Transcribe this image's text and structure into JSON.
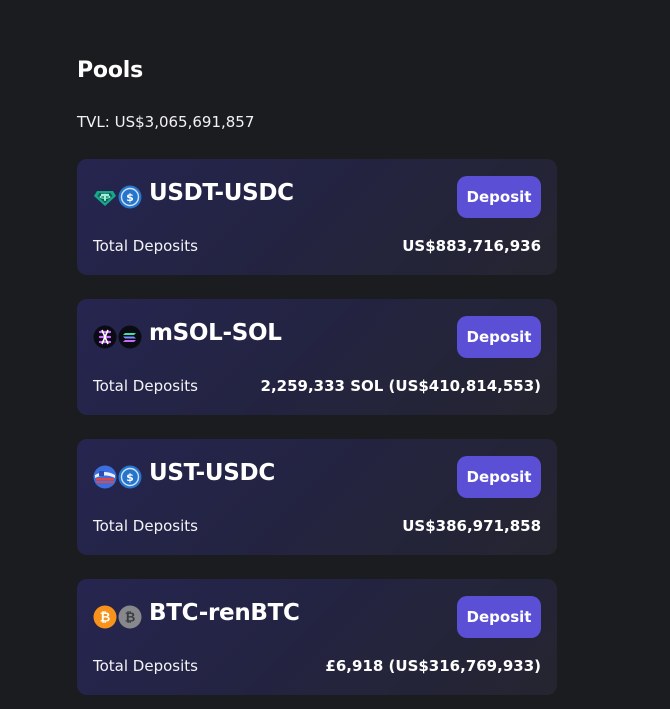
{
  "header": {
    "title": "Pools",
    "tvl_text": "TVL: US$3,065,691,857"
  },
  "colors": {
    "background": "#1b1c20",
    "card": "#24243f",
    "accent": "#5b4fd6"
  },
  "pools": [
    {
      "name": "USDT-USDC",
      "icons": [
        "usdt-icon",
        "usdc-icon"
      ],
      "deposit_label": "Deposit",
      "deposits_label": "Total Deposits",
      "deposits_value": "US$883,716,936"
    },
    {
      "name": "mSOL-SOL",
      "icons": [
        "msol-icon",
        "sol-icon"
      ],
      "deposit_label": "Deposit",
      "deposits_label": "Total Deposits",
      "deposits_value": "2,259,333 SOL (US$410,814,553)"
    },
    {
      "name": "UST-USDC",
      "icons": [
        "ust-icon",
        "usdc-icon"
      ],
      "deposit_label": "Deposit",
      "deposits_label": "Total Deposits",
      "deposits_value": "US$386,971,858"
    },
    {
      "name": "BTC-renBTC",
      "icons": [
        "btc-icon",
        "renbtc-icon"
      ],
      "deposit_label": "Deposit",
      "deposits_label": "Total Deposits",
      "deposits_value": "£6,918 (US$316,769,933)"
    }
  ]
}
